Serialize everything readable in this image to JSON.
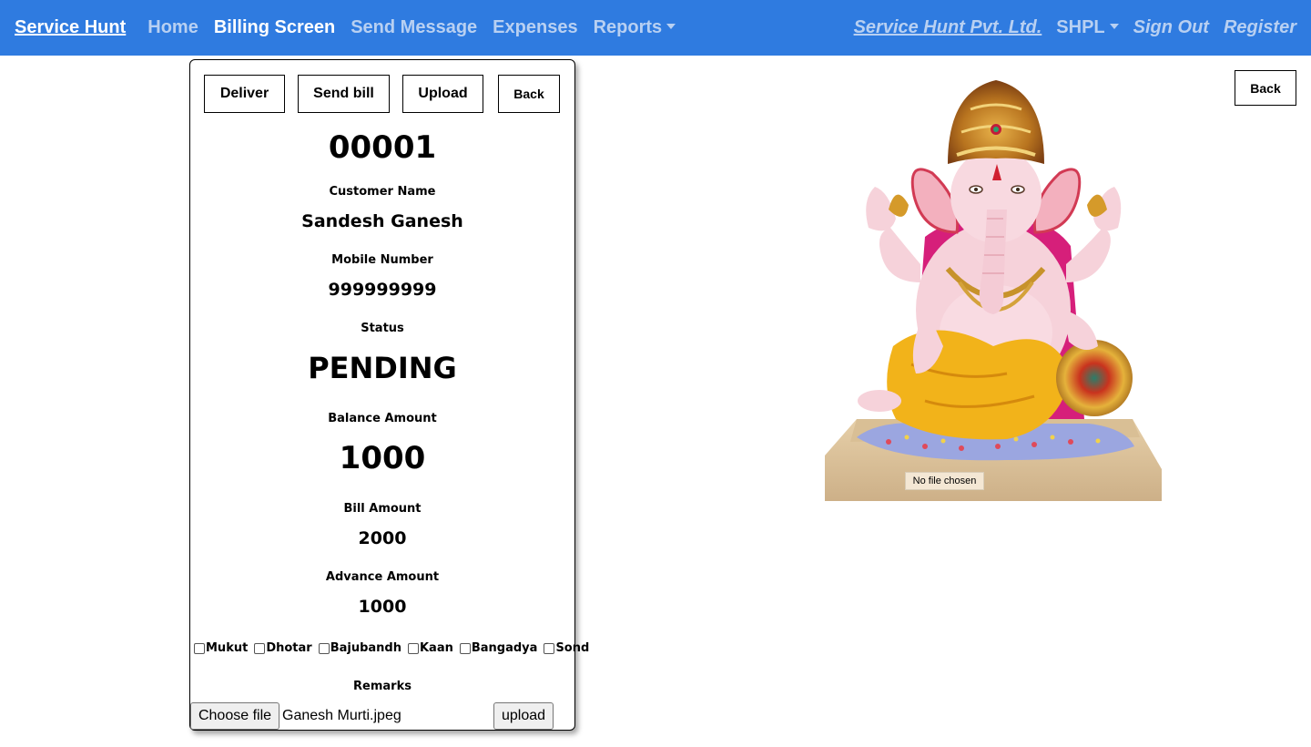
{
  "nav": {
    "brand": "Service Hunt",
    "links": [
      "Home",
      "Billing Screen",
      "Send Message",
      "Expenses",
      "Reports"
    ],
    "company": "Service Hunt Pvt. Ltd.",
    "org": "SHPL",
    "sign_out": "Sign Out",
    "register": "Register",
    "colors": {
      "bar": "#2f7be0",
      "active": "#ffffff",
      "inactive": "#b8d0f2"
    }
  },
  "actions": {
    "deliver": "Deliver",
    "send_bill": "Send bill",
    "upload": "Upload",
    "back": "Back"
  },
  "bill": {
    "number": "00001",
    "customer_label": "Customer Name",
    "customer_name": "Sandesh Ganesh",
    "mobile_label": "Mobile Number",
    "mobile": "999999999",
    "status_label": "Status",
    "status": "PENDING",
    "balance_label": "Balance Amount",
    "balance": "1000",
    "bill_label": "Bill Amount",
    "bill_amount": "2000",
    "advance_label": "Advance Amount",
    "advance": "1000",
    "remarks_label": "Remarks"
  },
  "ornaments": [
    {
      "label": "Mukut",
      "checked": false
    },
    {
      "label": "Dhotar",
      "checked": false
    },
    {
      "label": "Bajubandh",
      "checked": false
    },
    {
      "label": "Kaan",
      "checked": false
    },
    {
      "label": "Bangadya",
      "checked": false
    },
    {
      "label": "Sond",
      "checked": false
    }
  ],
  "file": {
    "choose_label": "Choose file",
    "file_name": "Ganesh Murti.jpeg",
    "upload_label": "upload"
  },
  "preview": {
    "back": "Back",
    "no_file": "No file chosen",
    "image": "ganesh-idol-image"
  }
}
